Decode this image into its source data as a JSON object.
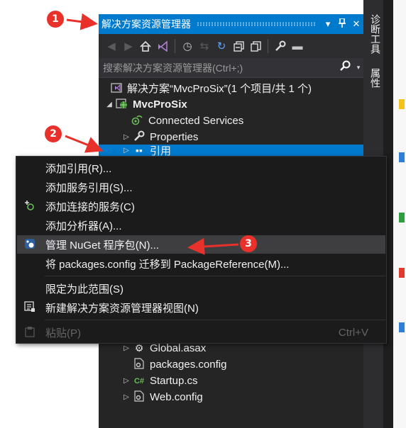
{
  "panel": {
    "title": "解决方案资源管理器",
    "pin_glyph": "⊥",
    "close_glyph": "✕",
    "dropdown_glyph": "▾"
  },
  "toolbar": {
    "icons": [
      "back-icon",
      "forward-icon",
      "home-icon",
      "vs-solution-icon",
      "history-icon",
      "sync-icon",
      "refresh-icon",
      "collapse-all-icon",
      "show-all-files-icon",
      "properties-wrench-icon",
      "preview-icon"
    ]
  },
  "search": {
    "placeholder": "搜索解决方案资源管理器(Ctrl+;)",
    "icon_glyph": "⚲",
    "drop_glyph": "▾"
  },
  "tree": {
    "solution": "解决方案“MvcProSix”(1 个项目/共 1 个)",
    "project": "MvcProSix",
    "items": [
      {
        "label": "Connected Services",
        "icon": "connected-services-icon"
      },
      {
        "label": "Properties",
        "icon": "wrench-icon"
      },
      {
        "label": "引用",
        "icon": "references-icon"
      }
    ],
    "bottom_items": [
      {
        "label": "Global.asax",
        "icon": "gear-file-icon"
      },
      {
        "label": "packages.config",
        "icon": "config-file-icon"
      },
      {
        "label": "Startup.cs",
        "icon": "csharp-file-icon",
        "glyph": "C#"
      },
      {
        "label": "Web.config",
        "icon": "config-file-icon"
      }
    ]
  },
  "side_tabs": [
    "诊断工具",
    "属性"
  ],
  "context_menu": {
    "items": [
      {
        "label": "添加引用(R)...",
        "icon": ""
      },
      {
        "label": "添加服务引用(S)...",
        "icon": ""
      },
      {
        "label": "添加连接的服务(C)",
        "icon": "add-connected-service-icon"
      },
      {
        "label": "添加分析器(A)...",
        "icon": ""
      },
      {
        "label": "管理 NuGet 程序包(N)...",
        "icon": "nuget-icon"
      },
      {
        "label": "将 packages.config 迁移到 PackageReference(M)...",
        "icon": ""
      },
      {
        "label": "限定为此范围(S)",
        "icon": ""
      },
      {
        "label": "新建解决方案资源管理器视图(N)",
        "icon": "new-view-icon"
      },
      {
        "label": "粘贴(P)",
        "icon": "paste-icon",
        "shortcut": "Ctrl+V"
      }
    ]
  },
  "callouts": [
    "1",
    "2",
    "3"
  ],
  "colors": {
    "accent": "#007acc",
    "panel_bg": "#252526",
    "menu_bg": "#1b1b1c",
    "callout": "#e8312b"
  }
}
